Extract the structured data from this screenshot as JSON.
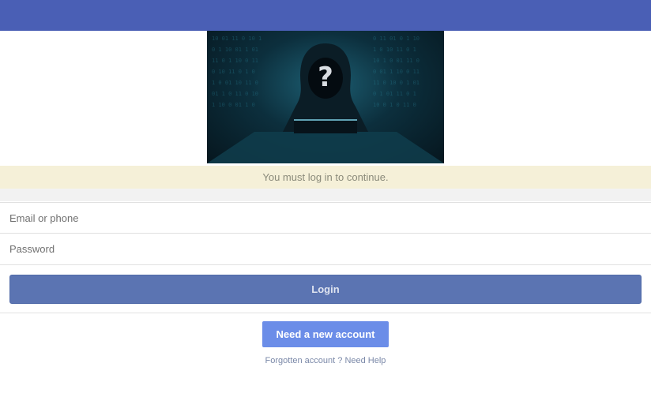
{
  "notice": {
    "text": "You must log in to continue."
  },
  "form": {
    "email_placeholder": "Email or phone",
    "password_placeholder": "Password",
    "login_label": "Login"
  },
  "signup": {
    "label": "Need a new account"
  },
  "help": {
    "forgotten": "Forgotten account ?",
    "need_help": "Need Help"
  },
  "colors": {
    "topbar": "#4a5fb5",
    "login_button": "#5b74b2",
    "signup_button": "#6b8de8",
    "notice_bg": "#f5f0d8"
  },
  "icons": {
    "hero": "hooded-hacker-image"
  }
}
